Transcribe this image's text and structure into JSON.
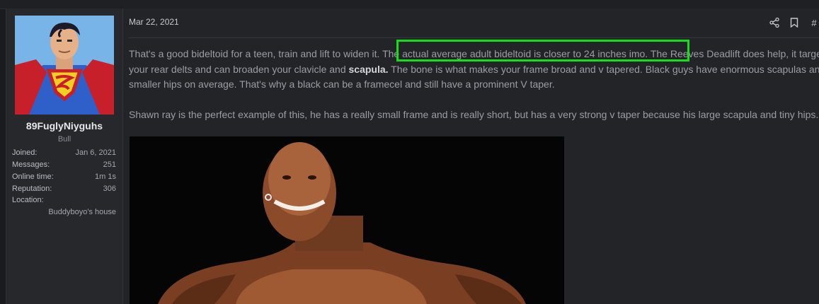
{
  "post": {
    "date": "Mar 22, 2021",
    "permalink_label": "#",
    "body": {
      "p1_a": "That's a good bideltoid for a teen, train and lift to widen it. ",
      "p1_highlight": "The actual average adult bideltoid is closer to 24 inches imo.",
      "p1_b": " The Reeves Deadlift does help, it targets your rear delts and can broaden your clavicle and ",
      "p1_bold": "scapula.",
      "p1_c": " The bone is what makes your frame broad and v tapered. Black guys have enormous scapulas and smaller hips on average. That's why a black can be a framecel and still have a prominent V taper.",
      "p2": "Shawn ray is the perfect example of this, he has a really small frame and is really short, but has a very strong v taper because his large scapula and tiny hips."
    },
    "highlight_color": "#12e01a"
  },
  "user": {
    "name": "89FuglyNiyguhs",
    "title": "Bull",
    "stats": [
      {
        "key": "Joined:",
        "value": "Jan 6, 2021"
      },
      {
        "key": "Messages:",
        "value": "251"
      },
      {
        "key": "Online time:",
        "value": "1m 1s"
      },
      {
        "key": "Reputation:",
        "value": "306"
      },
      {
        "key": "Location:",
        "value": ""
      }
    ],
    "location_value": "Buddyboyo's house"
  },
  "icons": {
    "share": "share-icon",
    "bookmark": "bookmark-icon"
  }
}
